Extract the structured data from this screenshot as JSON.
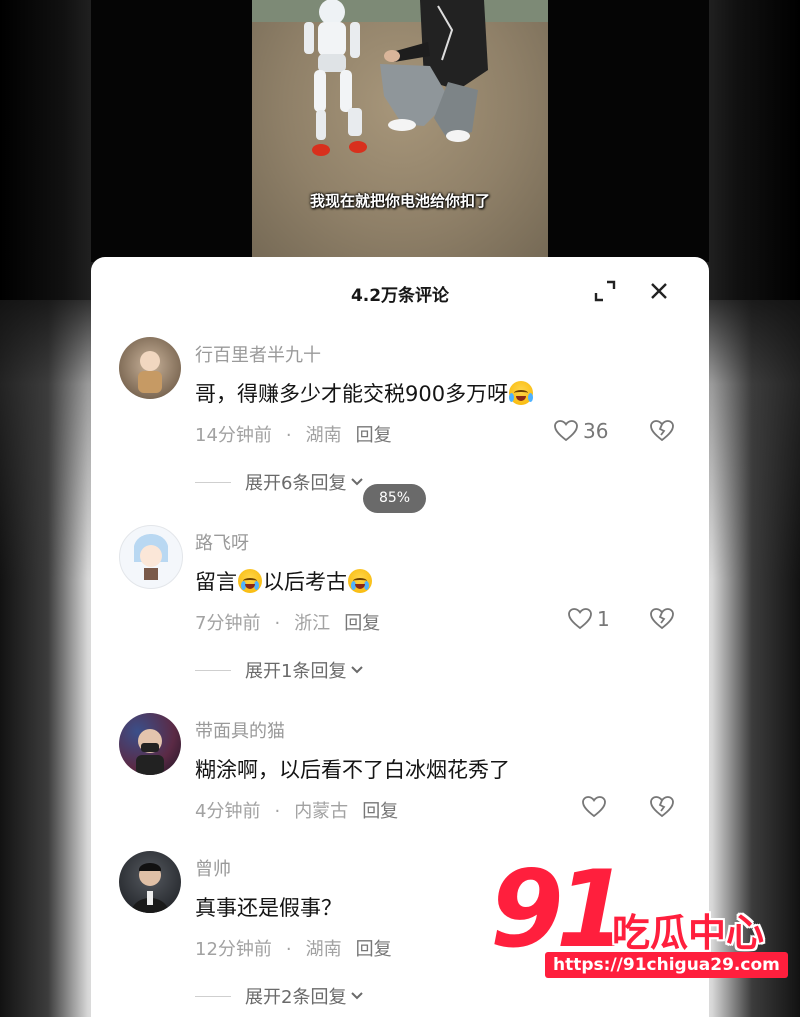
{
  "video": {
    "subtitle": "我现在就把你电池给你扣了"
  },
  "comments_panel": {
    "title": "4.2万条评论",
    "expand_icon": "expand-icon",
    "close_icon": "close-icon"
  },
  "comments": [
    {
      "author": "行百里者半九十",
      "text": "哥，得赚多少才能交税900多万呀",
      "emoji": "laugh-cry-emoji",
      "time": "14分钟前",
      "location": "湖南",
      "reply_label": "回复",
      "likes": "36",
      "expand_label": "展开6条回复"
    },
    {
      "author": "路飞呀",
      "text_before": "留言",
      "text_after": "以后考古",
      "emoji": "crying-emoji",
      "time": "7分钟前",
      "location": "浙江",
      "reply_label": "回复",
      "likes": "1",
      "expand_label": "展开1条回复"
    },
    {
      "author": "带面具的猫",
      "text": "糊涂啊，以后看不了白冰烟花秀了",
      "time": "4分钟前",
      "location": "内蒙古",
      "reply_label": "回复",
      "likes": ""
    },
    {
      "author": "曾帅",
      "text": "真事还是假事？",
      "time": "12分钟前",
      "location": "湖南",
      "reply_label": "回复",
      "likes": "",
      "expand_label": "展开2条回复"
    }
  ],
  "zoom_badge": "85%",
  "watermark": {
    "number": "91",
    "brand": "吃瓜中心",
    "url": "https://91chigua29.com"
  },
  "colors": {
    "accent": "#ff1f3d",
    "meta": "#a2a2a2"
  }
}
